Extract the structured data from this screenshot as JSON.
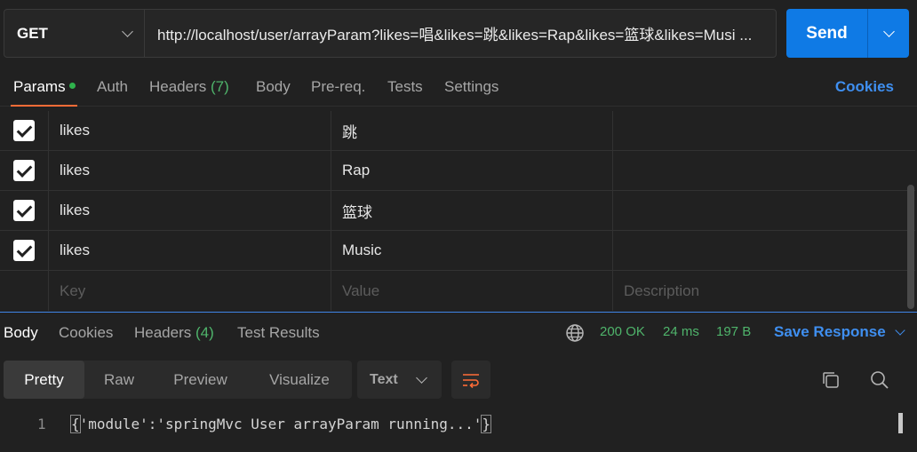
{
  "request": {
    "method": "GET",
    "url": "http://localhost/user/arrayParam?likes=唱&likes=跳&likes=Rap&likes=篮球&likes=Musi ...",
    "send_label": "Send"
  },
  "request_tabs": {
    "params": "Params",
    "auth": "Auth",
    "headers": "Headers",
    "headers_count": "(7)",
    "body": "Body",
    "prereq": "Pre-req.",
    "tests": "Tests",
    "settings": "Settings",
    "cookies": "Cookies"
  },
  "params": {
    "rows": [
      {
        "key": "likes",
        "value": "跳",
        "description": "",
        "checked": true
      },
      {
        "key": "likes",
        "value": "Rap",
        "description": "",
        "checked": true
      },
      {
        "key": "likes",
        "value": "篮球",
        "description": "",
        "checked": true
      },
      {
        "key": "likes",
        "value": "Music",
        "description": "",
        "checked": true
      }
    ],
    "placeholder": {
      "key": "Key",
      "value": "Value",
      "description": "Description"
    }
  },
  "response_tabs": {
    "body": "Body",
    "cookies": "Cookies",
    "headers": "Headers",
    "headers_count": "(4)",
    "test_results": "Test Results"
  },
  "response_status": {
    "status": "200 OK",
    "time": "24 ms",
    "size": "197 B",
    "save_response": "Save Response"
  },
  "view_modes": {
    "pretty": "Pretty",
    "raw": "Raw",
    "preview": "Preview",
    "visualize": "Visualize",
    "format": "Text"
  },
  "response_body": {
    "line_number": "1",
    "open_brace": "{",
    "content": "'module':'springMvc User arrayParam running...'",
    "close_brace": "}"
  },
  "colors": {
    "accent": "#ff6c37",
    "send": "#0f7ae5",
    "link": "#3f8ff0",
    "success": "#4fb46b"
  },
  "icons": [
    "chevron-down-icon",
    "globe-icon",
    "wrap-lines-icon",
    "copy-icon",
    "search-icon"
  ]
}
